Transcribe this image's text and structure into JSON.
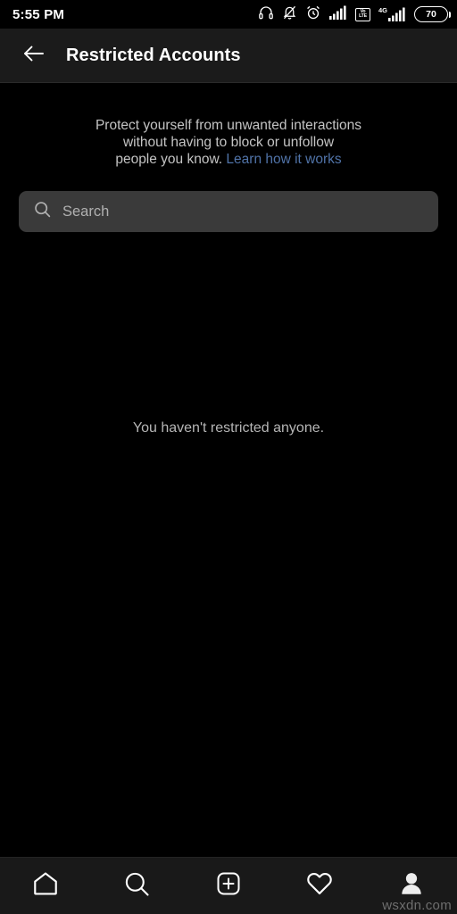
{
  "status_bar": {
    "time": "5:55 PM",
    "icons": [
      {
        "name": "headphones-icon"
      },
      {
        "name": "notifications-muted-icon"
      },
      {
        "name": "alarm-clock-icon"
      },
      {
        "name": "signal-bars-sim1-icon"
      },
      {
        "name": "volte-icon",
        "line1": "Vo",
        "line2": "LTE"
      },
      {
        "name": "signal-bars-sim2-icon",
        "network": "4G"
      }
    ],
    "battery_level": "70"
  },
  "header": {
    "back_label": "back-arrow",
    "title": "Restricted Accounts"
  },
  "main": {
    "description_line1": "Protect yourself from unwanted interactions",
    "description_line2": "without having to block or unfollow",
    "description_line3": "people you know. ",
    "learn_more_link": "Learn how it works",
    "search": {
      "value": "",
      "placeholder": "Search"
    },
    "empty_state": "You haven't restricted anyone."
  },
  "bottom_nav": {
    "items": [
      {
        "name": "home-icon",
        "label": "Home",
        "active": false
      },
      {
        "name": "search-icon",
        "label": "Search",
        "active": false
      },
      {
        "name": "add-post-icon",
        "label": "Create",
        "active": false
      },
      {
        "name": "heart-icon",
        "label": "Activity",
        "active": false
      },
      {
        "name": "profile-icon",
        "label": "Profile",
        "active": true
      }
    ]
  },
  "watermark": "wsxdn.com",
  "colors": {
    "background": "#000000",
    "header_background": "#1b1b1b",
    "nav_background": "#191919",
    "search_background": "#3a3a3a",
    "link": "#5073a8",
    "primary_text": "#ffffff",
    "secondary_text": "#c4c4c4"
  }
}
